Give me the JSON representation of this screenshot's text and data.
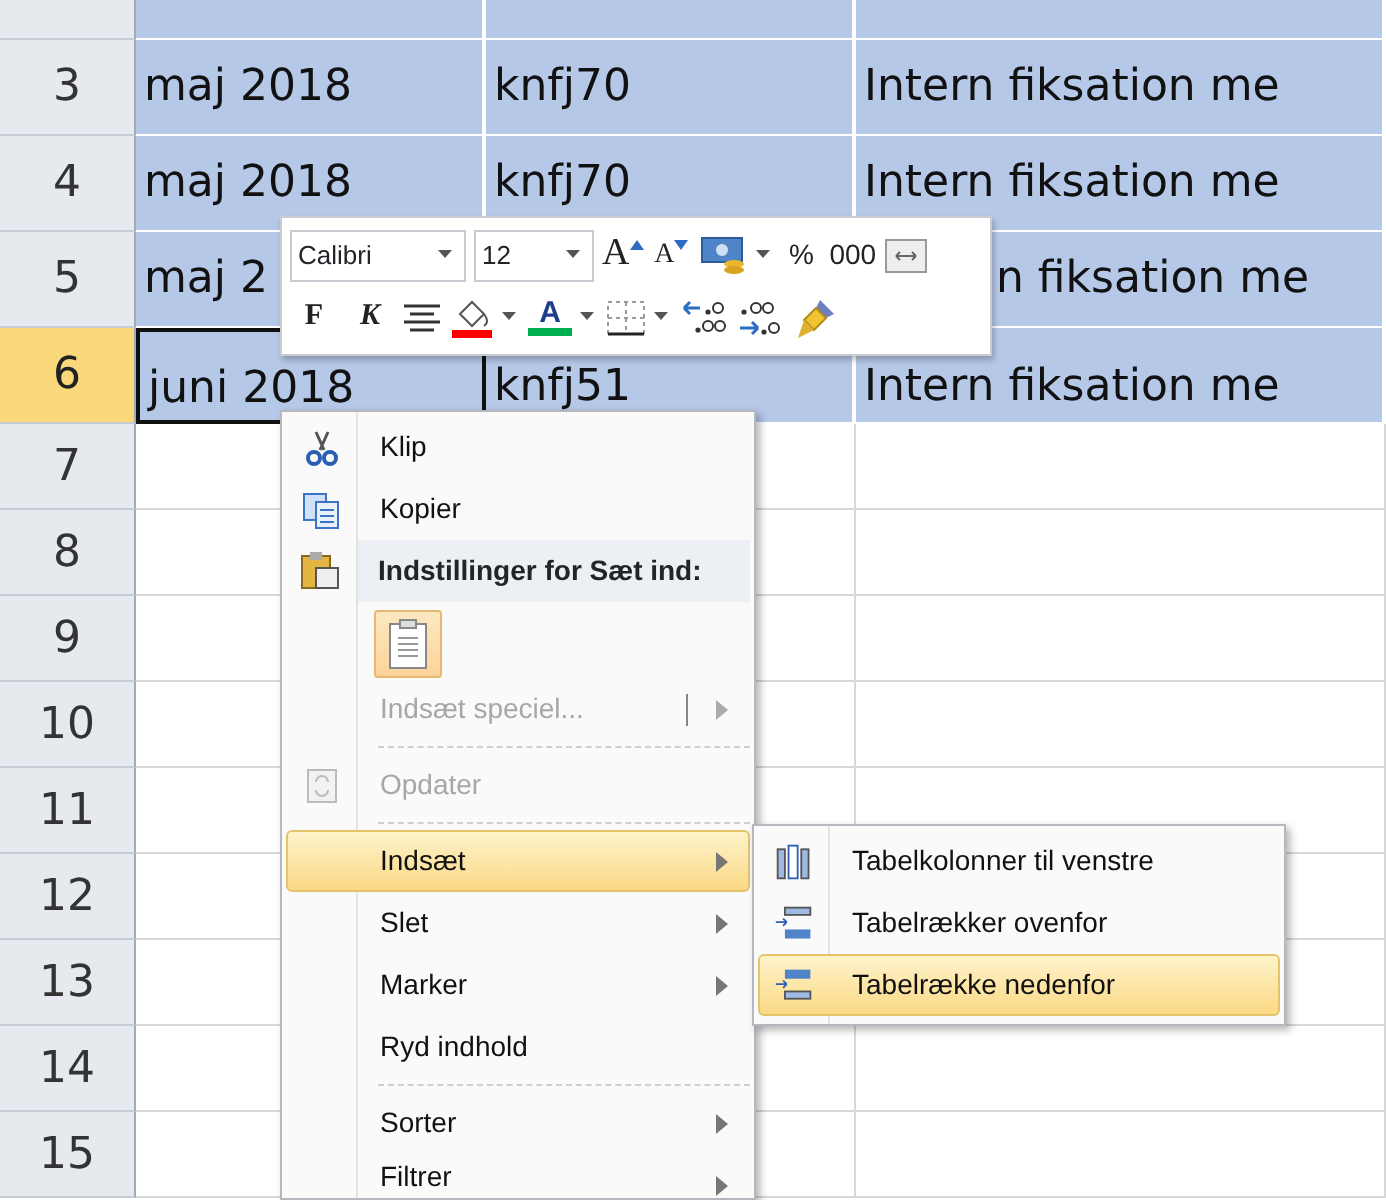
{
  "sheet": {
    "rows": [
      {
        "selected": true,
        "active": false,
        "cells": [
          {},
          {},
          {}
        ]
      },
      {
        "header": "3",
        "selected": true,
        "active": false,
        "cells": [
          {
            "text": "maj 2018"
          },
          {
            "text": "knfj70"
          },
          {
            "text": "Intern fiksation me"
          }
        ]
      },
      {
        "header": "4",
        "selected": true,
        "active": false,
        "cells": [
          {
            "text": "maj 2018"
          },
          {
            "text": "knfj70"
          },
          {
            "text": "Intern fiksation me"
          }
        ]
      },
      {
        "header": "5",
        "selected": true,
        "active": false,
        "cells": [
          {
            "text": "maj 2"
          },
          {},
          {
            "text": "n fiksation me",
            "covered": true
          }
        ]
      },
      {
        "header": "6",
        "selected": true,
        "active": true,
        "cells": [
          {
            "text": "juni 2018"
          },
          {
            "text": "knfj51"
          },
          {
            "text": "Intern fiksation me"
          }
        ]
      },
      {
        "header": "7",
        "selected": false,
        "active": false,
        "cells": [
          {},
          {},
          {}
        ]
      },
      {
        "header": "8",
        "selected": false,
        "active": false,
        "cells": [
          {},
          {},
          {}
        ]
      },
      {
        "header": "9",
        "selected": false,
        "active": false,
        "cells": [
          {},
          {},
          {}
        ]
      },
      {
        "header": "10",
        "selected": false,
        "active": false,
        "cells": [
          {},
          {},
          {}
        ]
      },
      {
        "header": "11",
        "selected": false,
        "active": false,
        "cells": [
          {},
          {},
          {}
        ]
      },
      {
        "header": "12",
        "selected": false,
        "active": false,
        "cells": [
          {},
          {},
          {}
        ]
      },
      {
        "header": "13",
        "selected": false,
        "active": false,
        "cells": [
          {},
          {},
          {}
        ]
      },
      {
        "header": "14",
        "selected": false,
        "active": false,
        "cells": [
          {},
          {},
          {}
        ]
      },
      {
        "header": "15",
        "selected": false,
        "active": false,
        "cells": [
          {},
          {},
          {}
        ]
      }
    ]
  },
  "mini_toolbar": {
    "font": "Calibri",
    "size": "12",
    "row1": [
      {
        "kind": "grow",
        "text": "A"
      },
      {
        "kind": "shrink",
        "text": "A"
      },
      {
        "kind": "accounting"
      },
      {
        "kind": "text",
        "text": "%"
      },
      {
        "kind": "text",
        "text": "000"
      },
      {
        "kind": "merge"
      }
    ],
    "row2": [
      {
        "kind": "bold",
        "text": "F"
      },
      {
        "kind": "italic",
        "text": "K"
      },
      {
        "kind": "center"
      },
      {
        "kind": "fill",
        "color": "#ff0000"
      },
      {
        "kind": "fontcolor",
        "text": "A",
        "color": "#00b050"
      },
      {
        "kind": "borders"
      },
      {
        "kind": "decdec"
      },
      {
        "kind": "incdec"
      },
      {
        "kind": "painter"
      }
    ]
  },
  "context_menu": {
    "items": [
      {
        "kind": "item",
        "label": "Klip",
        "disabled": false,
        "has_submenu": false,
        "selected": false
      },
      {
        "kind": "item",
        "label": "Kopier",
        "disabled": false,
        "has_submenu": false,
        "selected": false
      },
      {
        "kind": "header",
        "label": "Indstillinger for Sæt ind:"
      },
      {
        "kind": "paste-options"
      },
      {
        "kind": "item",
        "label": "Indsæt speciel...",
        "disabled": true,
        "has_submenu": true,
        "selected": false
      },
      {
        "kind": "separator"
      },
      {
        "kind": "item",
        "label": "Opdater",
        "disabled": true,
        "has_submenu": false,
        "selected": false
      },
      {
        "kind": "separator"
      },
      {
        "kind": "item",
        "label": "Indsæt",
        "disabled": false,
        "has_submenu": true,
        "selected": true
      },
      {
        "kind": "item",
        "label": "Slet",
        "disabled": false,
        "has_submenu": true,
        "selected": false
      },
      {
        "kind": "item",
        "label": "Marker",
        "disabled": false,
        "has_submenu": true,
        "selected": false
      },
      {
        "kind": "item",
        "label": "Ryd indhold",
        "disabled": false,
        "has_submenu": false,
        "selected": false
      },
      {
        "kind": "separator"
      },
      {
        "kind": "item",
        "label": "Sorter",
        "disabled": false,
        "has_submenu": true,
        "selected": false
      },
      {
        "kind": "item",
        "label": "Filtrer",
        "disabled": false,
        "has_submenu": true,
        "selected": false
      }
    ]
  },
  "submenu": {
    "items": [
      {
        "label": "Tabelkolonner til venstre",
        "selected": false
      },
      {
        "label": "Tabelrækker ovenfor",
        "selected": false
      },
      {
        "label": "Tabelrække nedenfor",
        "selected": true
      }
    ]
  }
}
